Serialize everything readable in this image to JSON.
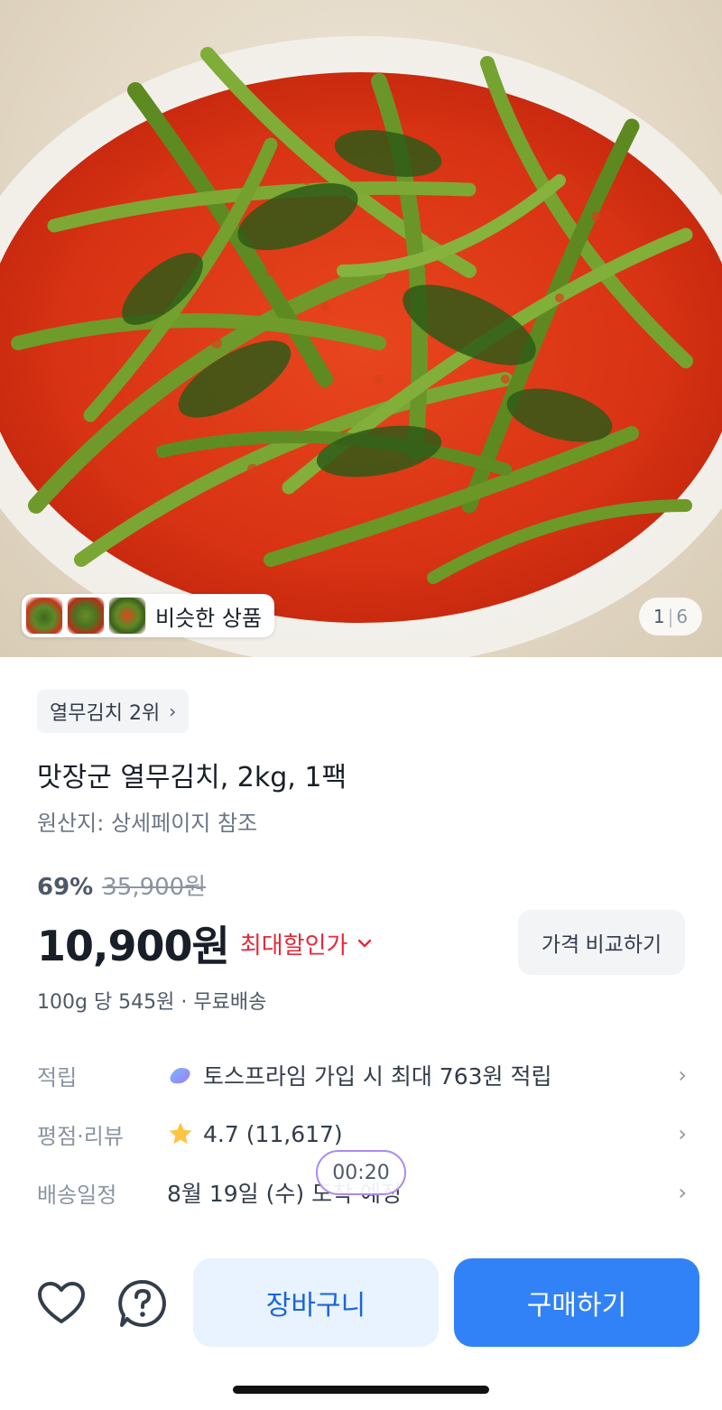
{
  "hero": {
    "similar_label": "비슷한 상품",
    "page_current": "1",
    "page_separator": "|",
    "page_total": "6"
  },
  "product": {
    "rank_label": "열무김치 2위",
    "title": "맛장군 열무김치, 2kg, 1팩",
    "origin": "원산지: 상세페이지 참조",
    "discount_rate": "69%",
    "original_price": "35,900원",
    "price": "10,900원",
    "max_discount_label": "최대할인가",
    "compare_button": "가격 비교하기",
    "unit_info": "100g 당 545원 · 무료배송"
  },
  "info_rows": {
    "points": {
      "label": "적립",
      "value": "토스프라임 가입 시 최대 763원 적립"
    },
    "rating": {
      "label": "평점·리뷰",
      "value": "4.7 (11,617)"
    },
    "delivery": {
      "label": "배송일정",
      "value": "8월 19일 (수) 도착 예정"
    }
  },
  "timer": "00:20",
  "bottom_bar": {
    "cart_label": "장바구니",
    "buy_label": "구매하기"
  },
  "colors": {
    "accent_blue": "#3182f6",
    "cart_bg": "#e8f3ff",
    "discount_red": "#e42939",
    "star_yellow": "#ffc342"
  },
  "icons": {
    "heart": "heart-icon",
    "question": "question-icon",
    "star": "star-icon",
    "prime": "toss-prime-icon",
    "chevron": "chevron-right-icon"
  }
}
